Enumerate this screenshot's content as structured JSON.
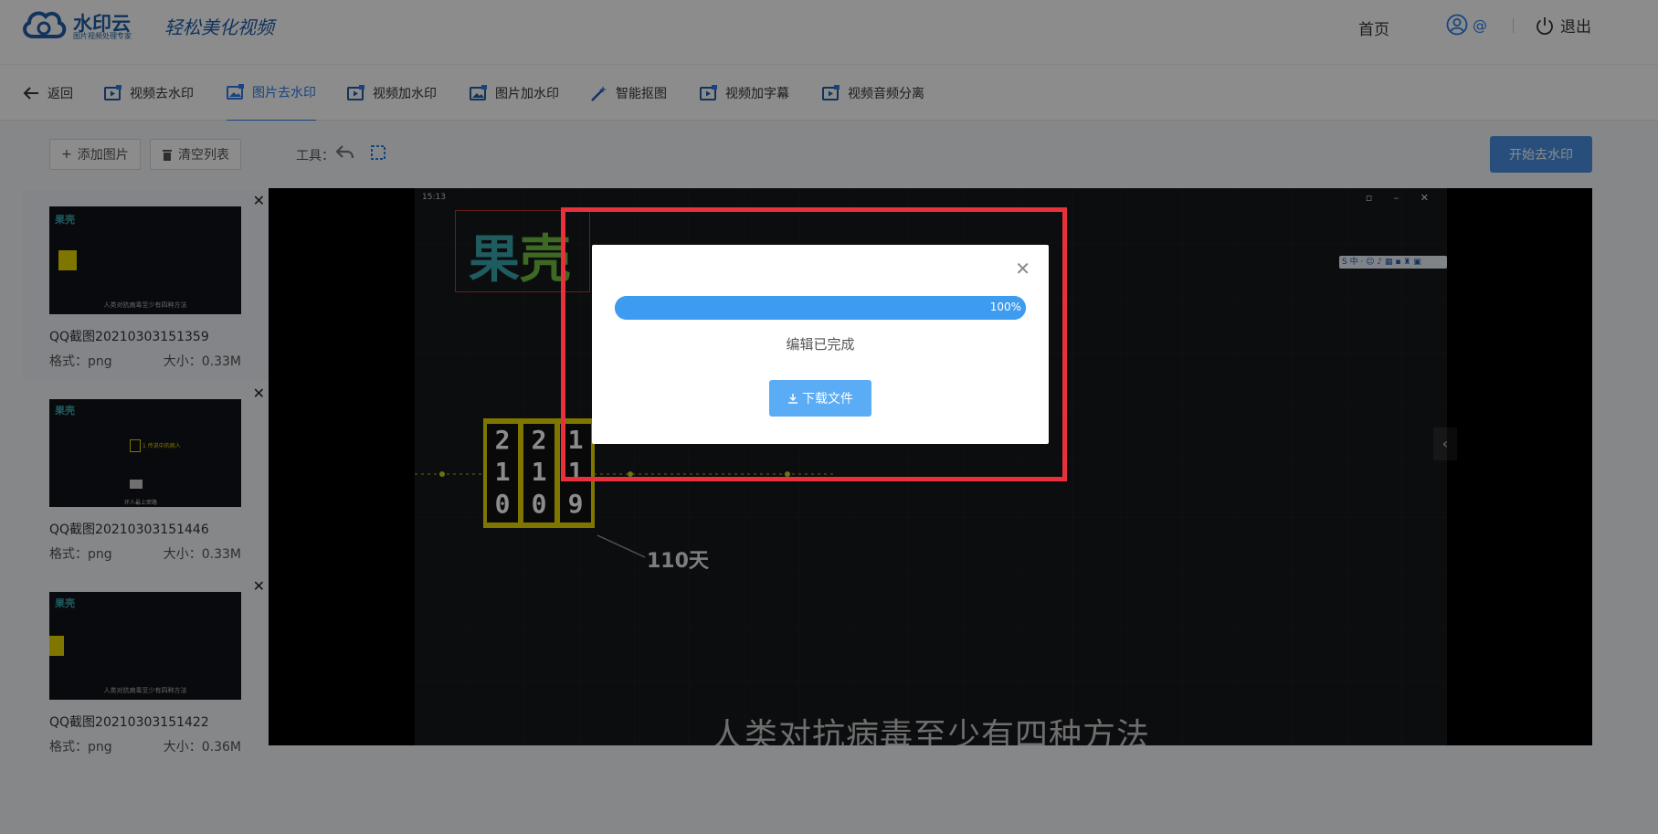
{
  "header": {
    "logo_title": "水印云",
    "logo_subtitle": "图片视频处理专家",
    "slogan": "轻松美化视频",
    "home": "首页",
    "user": "@",
    "logout": "退出"
  },
  "tabs": [
    {
      "label": "返回",
      "icon": "arrow-left-icon"
    },
    {
      "label": "视频去水印",
      "icon": "video-icon"
    },
    {
      "label": "图片去水印",
      "icon": "image-icon",
      "active": true
    },
    {
      "label": "视频加水印",
      "icon": "video-icon"
    },
    {
      "label": "图片加水印",
      "icon": "image-icon"
    },
    {
      "label": "智能抠图",
      "icon": "magic-wand-icon"
    },
    {
      "label": "视频加字幕",
      "icon": "video-icon"
    },
    {
      "label": "视频音频分离",
      "icon": "video-icon"
    }
  ],
  "sidebar": {
    "add_button": "添加图片",
    "clear_button": "清空列表",
    "files": [
      {
        "name": "QQ截图20210303151359",
        "format": "格式：png",
        "size": "大小：0.33M"
      },
      {
        "name": "QQ截图20210303151446",
        "format": "格式：png",
        "size": "大小：0.33M"
      },
      {
        "name": "QQ截图20210303151422",
        "format": "格式：png",
        "size": "大小：0.36M"
      }
    ]
  },
  "toolbar": {
    "label": "工具：",
    "start_button": "开始去水印"
  },
  "canvas": {
    "time": "15:13",
    "watermark_text": "果壳",
    "day_label": "110天",
    "caption": "人类对抗病毒至少有四种方法",
    "counter_digits": [
      [
        "2",
        "1",
        "0"
      ],
      [
        "2",
        "1",
        "0"
      ],
      [
        "1",
        "1",
        "9"
      ]
    ]
  },
  "modal": {
    "progress": 100,
    "progress_text": "100%",
    "status": "编辑已完成",
    "download_button": "下载文件"
  },
  "colors": {
    "accent": "#2b7de9",
    "highlight": "#e8313a",
    "progress": "#4aa0f2"
  }
}
